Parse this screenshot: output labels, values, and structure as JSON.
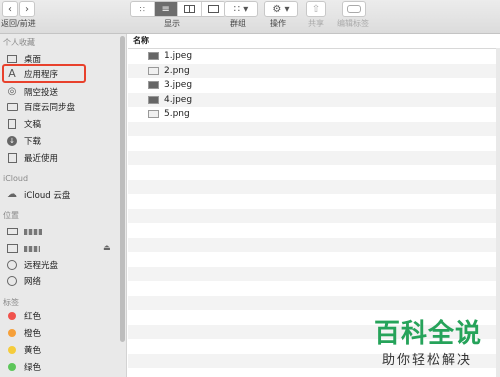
{
  "toolbar": {
    "nav_label": "返回/前进",
    "view_label": "显示",
    "group_label": "群组",
    "action_label": "操作",
    "share_label": "共享",
    "tags_label": "编辑标签"
  },
  "sidebar": {
    "favorites_header": "个人收藏",
    "favorites": [
      {
        "label": "桌面",
        "icon": "desktop-icon"
      },
      {
        "label": "应用程序",
        "icon": "applications-icon"
      },
      {
        "label": "隔空投送",
        "icon": "airdrop-icon"
      },
      {
        "label": "百度云同步盘",
        "icon": "folder-icon"
      },
      {
        "label": "文稿",
        "icon": "document-icon"
      },
      {
        "label": "下载",
        "icon": "download-icon"
      },
      {
        "label": "最近使用",
        "icon": "recents-icon"
      }
    ],
    "icloud_header": "iCloud",
    "icloud": [
      {
        "label": "iCloud 云盘",
        "icon": "cloud-icon"
      }
    ],
    "locations_header": "位置",
    "locations": [
      {
        "label": "",
        "icon": "laptop-icon"
      },
      {
        "label": "",
        "icon": "drive-icon"
      },
      {
        "label": "远程光盘",
        "icon": "disc-icon"
      },
      {
        "label": "网络",
        "icon": "network-icon"
      }
    ],
    "tags_header": "标签",
    "tags": [
      {
        "label": "红色",
        "color": "#f0524c"
      },
      {
        "label": "橙色",
        "color": "#f6a03a"
      },
      {
        "label": "黄色",
        "color": "#f5cc3c"
      },
      {
        "label": "绿色",
        "color": "#5dc65a"
      }
    ]
  },
  "content": {
    "column_name": "名称",
    "files": [
      {
        "name": "1.jpeg",
        "thumb": "dark"
      },
      {
        "name": "2.png",
        "thumb": "light"
      },
      {
        "name": "3.jpeg",
        "thumb": "dark"
      },
      {
        "name": "4.jpeg",
        "thumb": "dark"
      },
      {
        "name": "5.png",
        "thumb": "light"
      }
    ]
  },
  "watermark": {
    "title": "百科全说",
    "subtitle": "助你轻松解决"
  }
}
